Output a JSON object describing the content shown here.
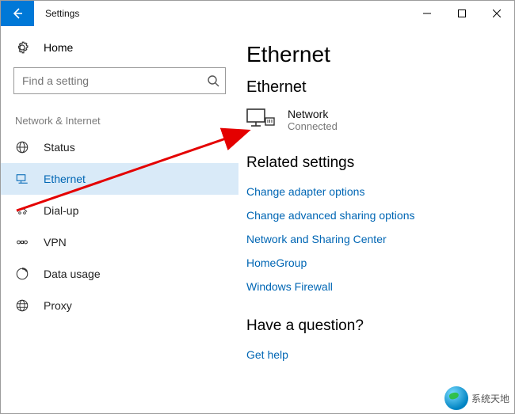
{
  "window": {
    "title": "Settings"
  },
  "sidebar": {
    "home_label": "Home",
    "search_placeholder": "Find a setting",
    "group_label": "Network & Internet",
    "items": [
      {
        "label": "Status"
      },
      {
        "label": "Ethernet"
      },
      {
        "label": "Dial-up"
      },
      {
        "label": "VPN"
      },
      {
        "label": "Data usage"
      },
      {
        "label": "Proxy"
      }
    ]
  },
  "main": {
    "heading": "Ethernet",
    "subheading": "Ethernet",
    "connection": {
      "name": "Network",
      "status": "Connected"
    },
    "related_heading": "Related settings",
    "related_links": [
      "Change adapter options",
      "Change advanced sharing options",
      "Network and Sharing Center",
      "HomeGroup",
      "Windows Firewall"
    ],
    "question_heading": "Have a question?",
    "question_link": "Get help"
  },
  "watermark": {
    "text": "系统天地"
  }
}
